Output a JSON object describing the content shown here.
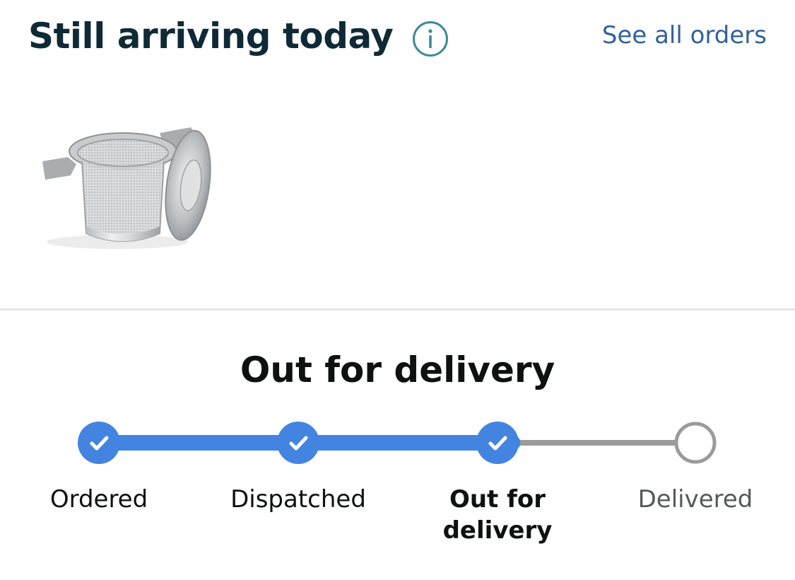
{
  "header": {
    "title": "Still arriving today",
    "info_icon": "info-circle-icon",
    "see_all_label": "See all orders"
  },
  "product": {
    "icon": "tea-infuser-product-image"
  },
  "tracking": {
    "status_title": "Out for delivery",
    "progress_fraction": 0.67,
    "steps": [
      {
        "label": "Ordered",
        "state": "complete"
      },
      {
        "label": "Dispatched",
        "state": "complete"
      },
      {
        "label": "Out for delivery",
        "state": "current"
      },
      {
        "label": "Delivered",
        "state": "pending"
      }
    ]
  },
  "colors": {
    "title": "#0f2a36",
    "info_icon": "#3b8a99",
    "link": "#336299",
    "progress_active": "#4384e0",
    "progress_pending": "#9b9b9b",
    "text": "#0f1111",
    "text_muted": "#565959"
  }
}
